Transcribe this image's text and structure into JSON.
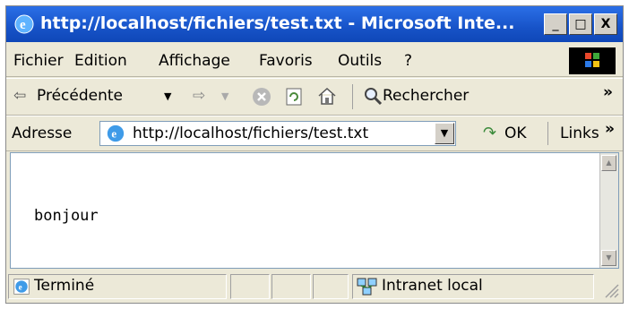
{
  "window": {
    "title": "http://localhost/fichiers/test.txt - Microsoft Inte...",
    "min_label": "_",
    "max_label": "□",
    "close_label": "X"
  },
  "menu": {
    "items": [
      "Fichier",
      "Edition",
      "Affichage",
      "Favoris",
      "Outils",
      "?"
    ]
  },
  "toolbar": {
    "back_label": "Précédente",
    "search_label": "Rechercher",
    "overflow": "»"
  },
  "address": {
    "label": "Adresse",
    "url": "http://localhost/fichiers/test.txt",
    "ok_label": "OK",
    "links_label": "Links",
    "overflow": "»"
  },
  "content": {
    "text": "bonjour"
  },
  "status": {
    "text": "Terminé",
    "zone": "Intranet local"
  },
  "colors": {
    "titlebar": "#1753c8",
    "chrome": "#ece9d8"
  }
}
